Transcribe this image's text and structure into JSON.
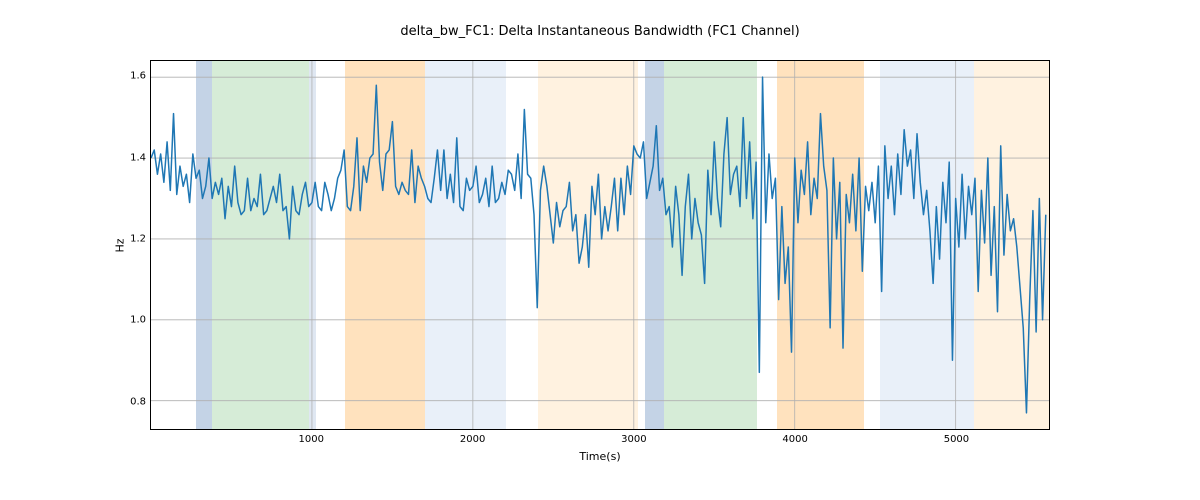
{
  "chart_data": {
    "type": "line",
    "title": "delta_bw_FC1: Delta Instantaneous Bandwidth (FC1 Channel)",
    "xlabel": "Time(s)",
    "ylabel": "Hz",
    "xlim": [
      0,
      5580
    ],
    "ylim": [
      0.73,
      1.64
    ],
    "xticks": [
      1000,
      2000,
      3000,
      4000,
      5000
    ],
    "yticks": [
      0.8,
      1.0,
      1.2,
      1.4,
      1.6
    ],
    "x_step": 20,
    "bands": [
      {
        "start": 280,
        "end": 380,
        "color": "#b0c4de",
        "alpha": 0.75
      },
      {
        "start": 380,
        "end": 980,
        "color": "#c8e6c9",
        "alpha": 0.75
      },
      {
        "start": 980,
        "end": 1020,
        "color": "#b0c4de",
        "alpha": 0.4
      },
      {
        "start": 1200,
        "end": 1700,
        "color": "#ffd8a8",
        "alpha": 0.75
      },
      {
        "start": 1700,
        "end": 2200,
        "color": "#d7e3f4",
        "alpha": 0.55
      },
      {
        "start": 2400,
        "end": 3020,
        "color": "#ffe7c7",
        "alpha": 0.55
      },
      {
        "start": 3060,
        "end": 3180,
        "color": "#b0c4de",
        "alpha": 0.75
      },
      {
        "start": 3180,
        "end": 3760,
        "color": "#c8e6c9",
        "alpha": 0.75
      },
      {
        "start": 3880,
        "end": 4420,
        "color": "#ffd8a8",
        "alpha": 0.75
      },
      {
        "start": 4520,
        "end": 5100,
        "color": "#d7e3f4",
        "alpha": 0.55
      },
      {
        "start": 5100,
        "end": 5580,
        "color": "#ffe7c7",
        "alpha": 0.55
      }
    ],
    "values": [
      1.4,
      1.42,
      1.36,
      1.41,
      1.34,
      1.44,
      1.32,
      1.51,
      1.31,
      1.38,
      1.33,
      1.36,
      1.29,
      1.41,
      1.35,
      1.37,
      1.3,
      1.33,
      1.4,
      1.3,
      1.34,
      1.31,
      1.35,
      1.25,
      1.33,
      1.28,
      1.38,
      1.29,
      1.26,
      1.27,
      1.35,
      1.27,
      1.3,
      1.28,
      1.36,
      1.26,
      1.27,
      1.3,
      1.33,
      1.29,
      1.36,
      1.27,
      1.28,
      1.2,
      1.33,
      1.27,
      1.26,
      1.31,
      1.34,
      1.28,
      1.29,
      1.34,
      1.28,
      1.27,
      1.34,
      1.31,
      1.27,
      1.3,
      1.35,
      1.37,
      1.42,
      1.28,
      1.27,
      1.33,
      1.45,
      1.27,
      1.38,
      1.34,
      1.4,
      1.41,
      1.58,
      1.39,
      1.32,
      1.41,
      1.42,
      1.49,
      1.33,
      1.31,
      1.34,
      1.32,
      1.31,
      1.42,
      1.29,
      1.38,
      1.35,
      1.33,
      1.3,
      1.29,
      1.35,
      1.42,
      1.32,
      1.42,
      1.3,
      1.36,
      1.29,
      1.45,
      1.28,
      1.27,
      1.35,
      1.32,
      1.33,
      1.38,
      1.29,
      1.31,
      1.35,
      1.28,
      1.38,
      1.29,
      1.3,
      1.34,
      1.31,
      1.37,
      1.36,
      1.32,
      1.41,
      1.3,
      1.52,
      1.36,
      1.35,
      1.26,
      1.03,
      1.32,
      1.38,
      1.33,
      1.26,
      1.19,
      1.29,
      1.23,
      1.27,
      1.28,
      1.34,
      1.22,
      1.26,
      1.14,
      1.18,
      1.26,
      1.13,
      1.33,
      1.26,
      1.36,
      1.2,
      1.28,
      1.22,
      1.28,
      1.35,
      1.22,
      1.35,
      1.26,
      1.38,
      1.31,
      1.43,
      1.41,
      1.4,
      1.44,
      1.3,
      1.34,
      1.38,
      1.48,
      1.32,
      1.35,
      1.26,
      1.28,
      1.18,
      1.33,
      1.26,
      1.11,
      1.28,
      1.36,
      1.2,
      1.3,
      1.24,
      1.21,
      1.09,
      1.37,
      1.26,
      1.44,
      1.3,
      1.23,
      1.41,
      1.5,
      1.31,
      1.36,
      1.38,
      1.28,
      1.5,
      1.3,
      1.44,
      1.25,
      1.39,
      0.87,
      1.6,
      1.24,
      1.41,
      1.3,
      1.35,
      1.05,
      1.28,
      1.09,
      1.18,
      0.92,
      1.4,
      1.24,
      1.37,
      1.31,
      1.44,
      1.26,
      1.35,
      1.3,
      1.51,
      1.38,
      1.32,
      0.98,
      1.4,
      1.2,
      1.34,
      0.93,
      1.31,
      1.24,
      1.36,
      1.22,
      1.4,
      1.12,
      1.33,
      1.27,
      1.34,
      1.24,
      1.38,
      1.07,
      1.43,
      1.3,
      1.38,
      1.26,
      1.41,
      1.31,
      1.47,
      1.38,
      1.42,
      1.3,
      1.46,
      1.34,
      1.26,
      1.32,
      1.22,
      1.09,
      1.28,
      1.15,
      1.34,
      1.24,
      1.39,
      0.9,
      1.3,
      1.18,
      1.36,
      1.2,
      1.33,
      1.26,
      1.35,
      1.07,
      1.32,
      1.19,
      1.4,
      1.11,
      1.28,
      1.02,
      1.43,
      1.16,
      1.31,
      1.22,
      1.25,
      1.18,
      1.08,
      0.98,
      0.77,
      1.05,
      1.27,
      0.97,
      1.3,
      1.0,
      1.26
    ]
  }
}
